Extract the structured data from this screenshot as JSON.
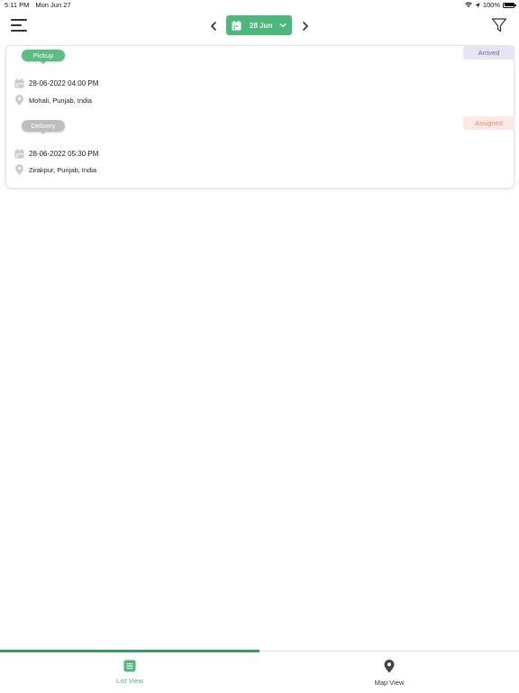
{
  "status_bar": {
    "time": "5:11 PM",
    "date": "Mon Jun 27",
    "battery": "100%"
  },
  "header": {
    "date_label": "28 Jun",
    "accent_color": "#4cb87c"
  },
  "job": {
    "stops": [
      {
        "type": "Pickup",
        "status": "Arrived",
        "datetime": "28-06-2022 04:00 PM",
        "address": "Mohali, Punjab, India"
      },
      {
        "type": "Delivery",
        "status": "Assigned",
        "datetime": "28-06-2022 05:30 PM",
        "address": "Zirakpur, Punjab, India"
      }
    ]
  },
  "tabs": [
    {
      "label": "List View",
      "icon": "list-icon",
      "active": true
    },
    {
      "label": "Map View",
      "icon": "map-pin-icon",
      "active": false
    }
  ]
}
